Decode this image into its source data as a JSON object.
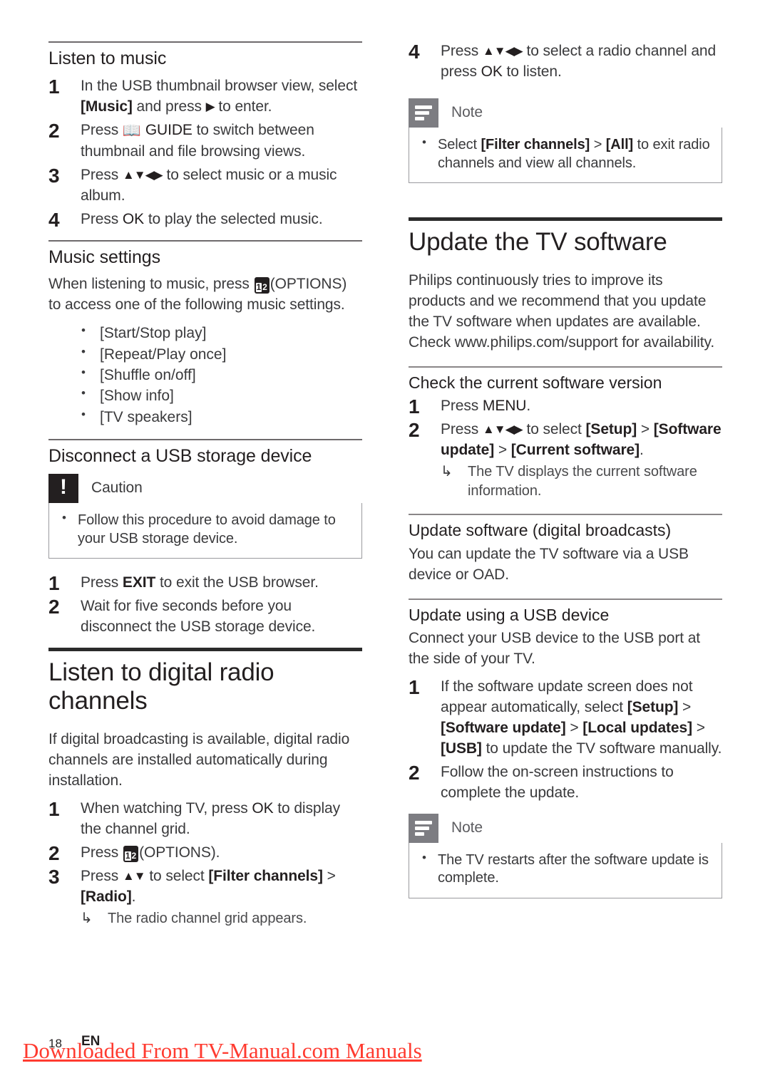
{
  "left_column": {
    "listen_to_music": {
      "title": "Listen to music",
      "steps": [
        {
          "num": "1",
          "text_a": "In the USB thumbnail browser view, select ",
          "bold_a": "[Music]",
          "text_b": " and press ",
          "glyph": "▶",
          "text_c": " to enter."
        },
        {
          "num": "2",
          "text_a": "Press ",
          "icon": "book-icon",
          "key": " GUIDE",
          "text_b": " to switch between thumbnail and file browsing views."
        },
        {
          "num": "3",
          "text_a": "Press ",
          "arrows": "▲▼◀▶",
          "text_b": " to select music or a music album."
        },
        {
          "num": "4",
          "text_a": "Press ",
          "key": "OK",
          "text_b": " to play the selected music."
        }
      ]
    },
    "music_settings": {
      "title": "Music settings",
      "intro_a": "When listening to music, press ",
      "intro_icon": "options-icon",
      "intro_b": "(OPTIONS) to access one of the following music settings.",
      "options": [
        "[Start/Stop play]",
        "[Repeat/Play once]",
        "[Shuffle on/off]",
        "[Show info]",
        "[TV speakers]"
      ]
    },
    "disconnect_usb": {
      "title": "Disconnect a USB storage device",
      "caution": {
        "label": "Caution",
        "items": [
          "Follow this procedure to avoid damage to your USB storage device."
        ]
      },
      "steps": [
        {
          "num": "1",
          "text_a": "Press ",
          "key": "EXIT",
          "text_b": " to exit the USB browser."
        },
        {
          "num": "2",
          "text_a": "Wait for five seconds before you disconnect the USB storage device."
        }
      ]
    },
    "digital_radio": {
      "title": "Listen to digital radio channels",
      "intro": "If digital broadcasting is available, digital radio channels are installed automatically during installation.",
      "steps": [
        {
          "num": "1",
          "text_a": "When watching TV, press ",
          "key": "OK",
          "text_b": " to display the channel grid."
        },
        {
          "num": "2",
          "text_a": "Press ",
          "icon": "options-icon",
          "text_b": "(OPTIONS)."
        },
        {
          "num": "3",
          "text_a": "Press ",
          "arrows": "▲▼",
          "text_b": " to select ",
          "bold_a": "[Filter channels]",
          "text_c": " > ",
          "bold_b": "[Radio]",
          "text_d": ".",
          "result": "The radio channel grid appears."
        }
      ]
    }
  },
  "right_column": {
    "radio_step4": {
      "num": "4",
      "text_a": "Press ",
      "arrows": "▲▼◀▶",
      "text_b": " to select a radio channel and press ",
      "key": "OK",
      "text_c": " to listen."
    },
    "note_radio": {
      "label": "Note",
      "items_html": [
        {
          "pre": "Select ",
          "bold_a": "[Filter channels]",
          "mid": " > ",
          "bold_b": "[All]",
          "post": " to exit radio channels and view all channels."
        }
      ]
    },
    "update_tv_software": {
      "title": "Update the TV software",
      "intro": "Philips continuously tries to improve its products and we recommend that you update the TV software when updates are available. Check www.philips.com/support for availability."
    },
    "check_version": {
      "title": "Check the current software version",
      "steps": [
        {
          "num": "1",
          "text_a": "Press ",
          "key": "MENU",
          "text_b": "."
        },
        {
          "num": "2",
          "text_a": "Press ",
          "arrows": "▲▼◀▶",
          "text_b": " to select ",
          "bold_a": "[Setup]",
          "text_c": " > ",
          "bold_b": "[Software update]",
          "text_d": " > ",
          "bold_c": "[Current software]",
          "text_e": ".",
          "result": "The TV displays the current software information."
        }
      ]
    },
    "update_digital": {
      "title": "Update software (digital broadcasts)",
      "body": "You can update the TV software via a USB device or OAD."
    },
    "update_usb": {
      "title": "Update using a USB device",
      "intro": "Connect your USB device to the USB port at the side of your TV.",
      "steps": [
        {
          "num": "1",
          "text_a": "If the software update screen does not appear automatically, select ",
          "bold_a": "[Setup]",
          "text_b": " > ",
          "bold_b": "[Software update]",
          "text_c": " > ",
          "bold_c": "[Local updates]",
          "text_d": " > ",
          "bold_d": "[USB]",
          "text_e": " to update the TV software manually."
        },
        {
          "num": "2",
          "text_a": "Follow the on-screen instructions to complete the update."
        }
      ],
      "note": {
        "label": "Note",
        "items": [
          "The TV restarts after the software update is complete."
        ]
      }
    }
  },
  "footer": {
    "page_number": "18",
    "language": "EN",
    "watermark": "Downloaded From TV-Manual.com Manuals"
  },
  "colors": {
    "text": "#3a3a3c",
    "heading": "#231f20",
    "note_badge": "#7d7d82",
    "caution_badge": "#231f20",
    "watermark": "#ff3b30",
    "box_border": "#9a9a9e"
  }
}
